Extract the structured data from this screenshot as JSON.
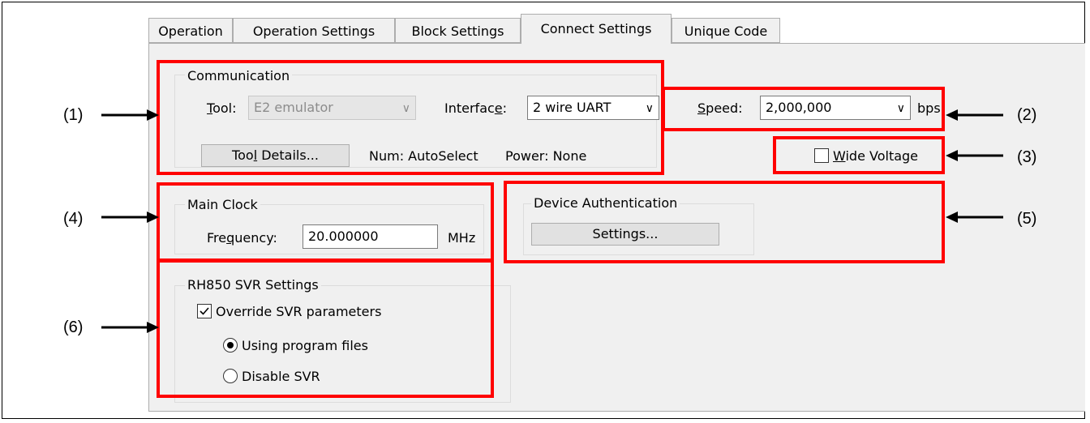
{
  "tabs": [
    {
      "label": "Operation",
      "active": false
    },
    {
      "label": "Operation Settings",
      "active": false
    },
    {
      "label": "Block Settings",
      "active": false
    },
    {
      "label": "Connect Settings",
      "active": true
    },
    {
      "label": "Unique Code",
      "active": false
    }
  ],
  "communication": {
    "group_label": "Communication",
    "tool_label_prefix": "T",
    "tool_label_rest": "ool:",
    "tool_value": "E2 emulator",
    "interface_label_prefix": "Interfac",
    "interface_label_u": "e",
    "interface_label_suffix": ":",
    "interface_value": "2 wire UART",
    "tool_details_prefix": "Too",
    "tool_details_u": "l",
    "tool_details_suffix": " Details...",
    "num_text": "Num: AutoSelect",
    "power_text": "Power: None"
  },
  "speed": {
    "label_u": "S",
    "label_rest": "peed:",
    "value": "2,000,000",
    "unit": "bps"
  },
  "wide_voltage": {
    "label_u": "W",
    "label_rest": "ide Voltage",
    "checked": false
  },
  "main_clock": {
    "group_label": "Main Clock",
    "frequency_label_prefix": "Fre",
    "frequency_label_u": "q",
    "frequency_label_suffix": "uency:",
    "frequency_value": "20.000000",
    "unit": "MHz"
  },
  "device_auth": {
    "group_label": "Device Authentication",
    "settings_button": "Settings..."
  },
  "svr": {
    "group_label": "RH850 SVR Settings",
    "override_label": "Override SVR parameters",
    "override_checked": true,
    "radio_program_files": "Using program files",
    "radio_disable": "Disable SVR",
    "selected": "Using program files"
  },
  "callouts": {
    "c1": "(1)",
    "c2": "(2)",
    "c3": "(3)",
    "c4": "(4)",
    "c5": "(5)",
    "c6": "(6)"
  },
  "colors": {
    "highlight": "#ff0000",
    "panel_bg": "#f0f0f0"
  },
  "icons": [
    "chevron-down-icon",
    "checkbox-icon",
    "radio-icon",
    "arrow-right-icon",
    "arrow-left-icon"
  ]
}
